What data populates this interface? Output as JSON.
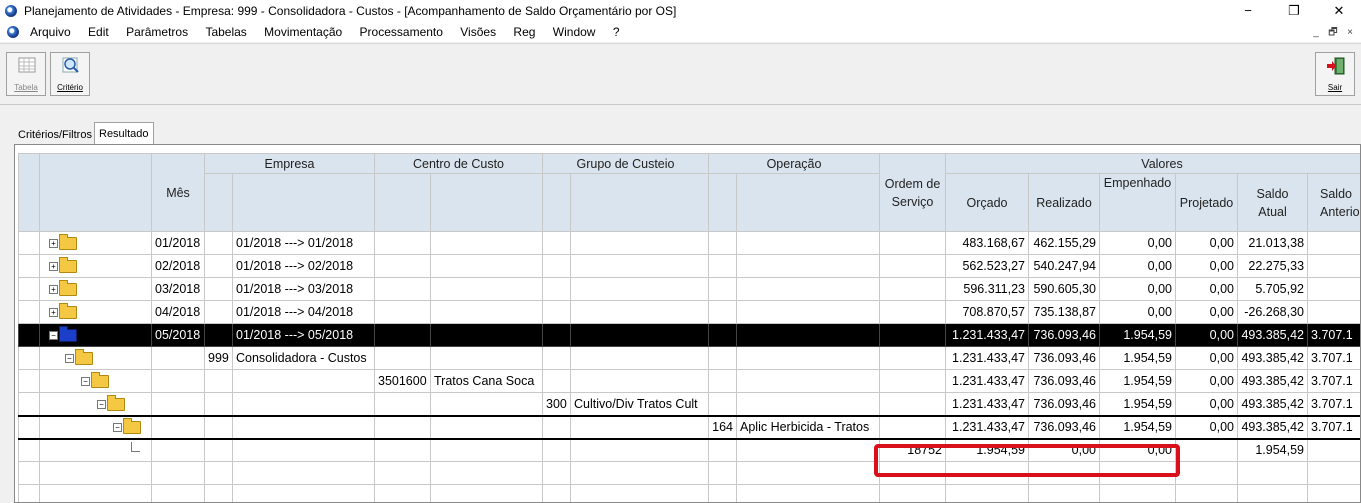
{
  "window": {
    "title": "Planejamento de Atividades  - Empresa: 999 - Consolidadora - Custos - [Acompanhamento de Saldo Orçamentário por OS]",
    "minimize": "−",
    "maximize": "❐",
    "close": "✕"
  },
  "menu": {
    "items": [
      "Arquivo",
      "Edit",
      "Parâmetros",
      "Tabelas",
      "Movimentação",
      "Processamento",
      "Visões",
      "Reg",
      "Window",
      "?"
    ],
    "mdi_minimize": "_",
    "mdi_restore": "🗗",
    "mdi_close": "×"
  },
  "toolbar": {
    "tabela_label": "Tabela",
    "criterio_label": "Critério",
    "sair_label": "Sair"
  },
  "tabs": {
    "criterios": "Critérios/Filtros",
    "resultado": "Resultado"
  },
  "grid": {
    "headers": {
      "mes": "Mês",
      "empresa": "Empresa",
      "centro_custo": "Centro de Custo",
      "grupo_custeio": "Grupo de Custeio",
      "operacao": "Operação",
      "ordem_servico": "Ordem de Serviço",
      "valores": "Valores",
      "orcado": "Orçado",
      "realizado": "Realizado",
      "empenhado": "Empenhado",
      "projetado": "Projetado",
      "saldo_atual": "Saldo Atual",
      "saldo_anterior": "Saldo Anterior"
    },
    "rows": [
      {
        "mes": "01/2018",
        "range": "01/2018 ---> 01/2018",
        "orcado": "483.168,67",
        "realizado": "462.155,29",
        "empenhado": "0,00",
        "projetado": "0,00",
        "saldo": "21.013,38",
        "saldo_ant": ""
      },
      {
        "mes": "02/2018",
        "range": "01/2018 ---> 02/2018",
        "orcado": "562.523,27",
        "realizado": "540.247,94",
        "empenhado": "0,00",
        "projetado": "0,00",
        "saldo": "22.275,33",
        "saldo_ant": ""
      },
      {
        "mes": "03/2018",
        "range": "01/2018 ---> 03/2018",
        "orcado": "596.311,23",
        "realizado": "590.605,30",
        "empenhado": "0,00",
        "projetado": "0,00",
        "saldo": "5.705,92",
        "saldo_ant": ""
      },
      {
        "mes": "04/2018",
        "range": "01/2018 ---> 04/2018",
        "orcado": "708.870,57",
        "realizado": "735.138,87",
        "empenhado": "0,00",
        "projetado": "0,00",
        "saldo": "-26.268,30",
        "saldo_ant": ""
      },
      {
        "mes": "05/2018",
        "range": "01/2018 ---> 05/2018",
        "orcado": "1.231.433,47",
        "realizado": "736.093,46",
        "empenhado": "1.954,59",
        "projetado": "0,00",
        "saldo": "493.385,42",
        "saldo_ant": "3.707.1"
      }
    ],
    "empresa_row": {
      "codigo": "999",
      "nome": "Consolidadora - Custos",
      "orcado": "1.231.433,47",
      "realizado": "736.093,46",
      "empenhado": "1.954,59",
      "projetado": "0,00",
      "saldo": "493.385,42",
      "saldo_ant": "3.707.1"
    },
    "centro_row": {
      "codigo": "3501600",
      "nome": "Tratos Cana Soca",
      "orcado": "1.231.433,47",
      "realizado": "736.093,46",
      "empenhado": "1.954,59",
      "projetado": "0,00",
      "saldo": "493.385,42",
      "saldo_ant": "3.707.1"
    },
    "grupo_row": {
      "codigo": "300",
      "nome": "Cultivo/Div Tratos Cult",
      "orcado": "1.231.433,47",
      "realizado": "736.093,46",
      "empenhado": "1.954,59",
      "projetado": "0,00",
      "saldo": "493.385,42",
      "saldo_ant": "3.707.1"
    },
    "operacao_row": {
      "codigo": "164",
      "nome": "Aplic Herbicida - Tratos",
      "orcado": "1.231.433,47",
      "realizado": "736.093,46",
      "empenhado": "1.954,59",
      "projetado": "0,00",
      "saldo": "493.385,42",
      "saldo_ant": "3.707.1"
    },
    "os_row": {
      "ordem": "18752",
      "orcado": "1.954,59",
      "realizado": "0,00",
      "empenhado": "0,00",
      "projetado": "",
      "saldo": "1.954,59",
      "saldo_ant": ""
    }
  },
  "colors": {
    "header_bg": "#d9e4ee",
    "selected_bg": "#000000",
    "highlight_border": "#d8101c",
    "folder": "#f4c842",
    "folder_open_selected": "#1b3fc9"
  }
}
